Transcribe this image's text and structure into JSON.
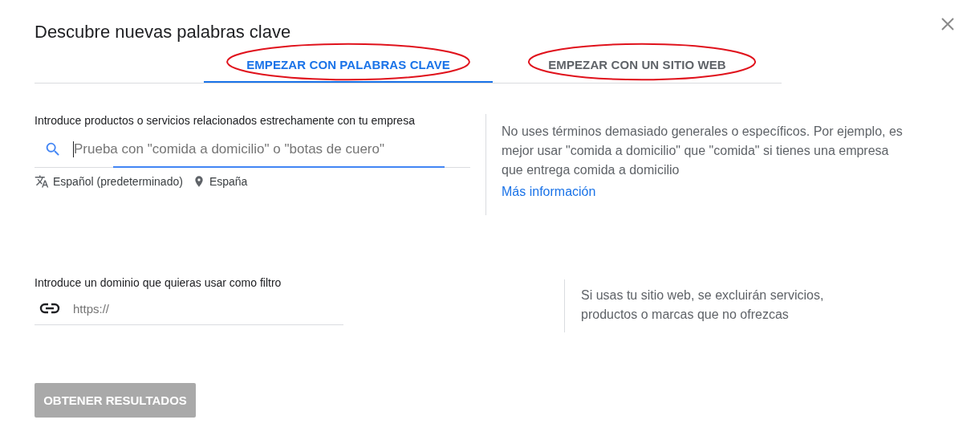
{
  "dialog": {
    "title": "Descubre nuevas palabras clave"
  },
  "tabs": [
    {
      "label": "EMPEZAR CON PALABRAS CLAVE",
      "selected": true,
      "circled": true
    },
    {
      "label": "EMPEZAR CON UN SITIO WEB",
      "selected": false,
      "circled": true
    }
  ],
  "keywords_section": {
    "label": "Introduce productos o servicios relacionados estrechamente con tu empresa",
    "search": {
      "placeholder": "Prueba con \"comida a domicilio\" o \"botas de cuero\"",
      "focused": true
    },
    "language": "Español (predeterminado)",
    "location": "España",
    "hint": "No uses términos demasiado generales o específicos. Por ejemplo, es mejor usar \"comida a domicilio\" que \"comida\" si tienes una empresa que entrega comida a domicilio",
    "link": "Más información"
  },
  "domain_section": {
    "label": "Introduce un dominio que quieras usar como filtro",
    "field": {
      "placeholder": "https://"
    },
    "hint": "Si usas tu sitio web, se excluirán servicios, productos o marcas que no ofrezcas"
  },
  "submit": {
    "label": "OBTENER RESULTADOS",
    "disabled": true
  }
}
